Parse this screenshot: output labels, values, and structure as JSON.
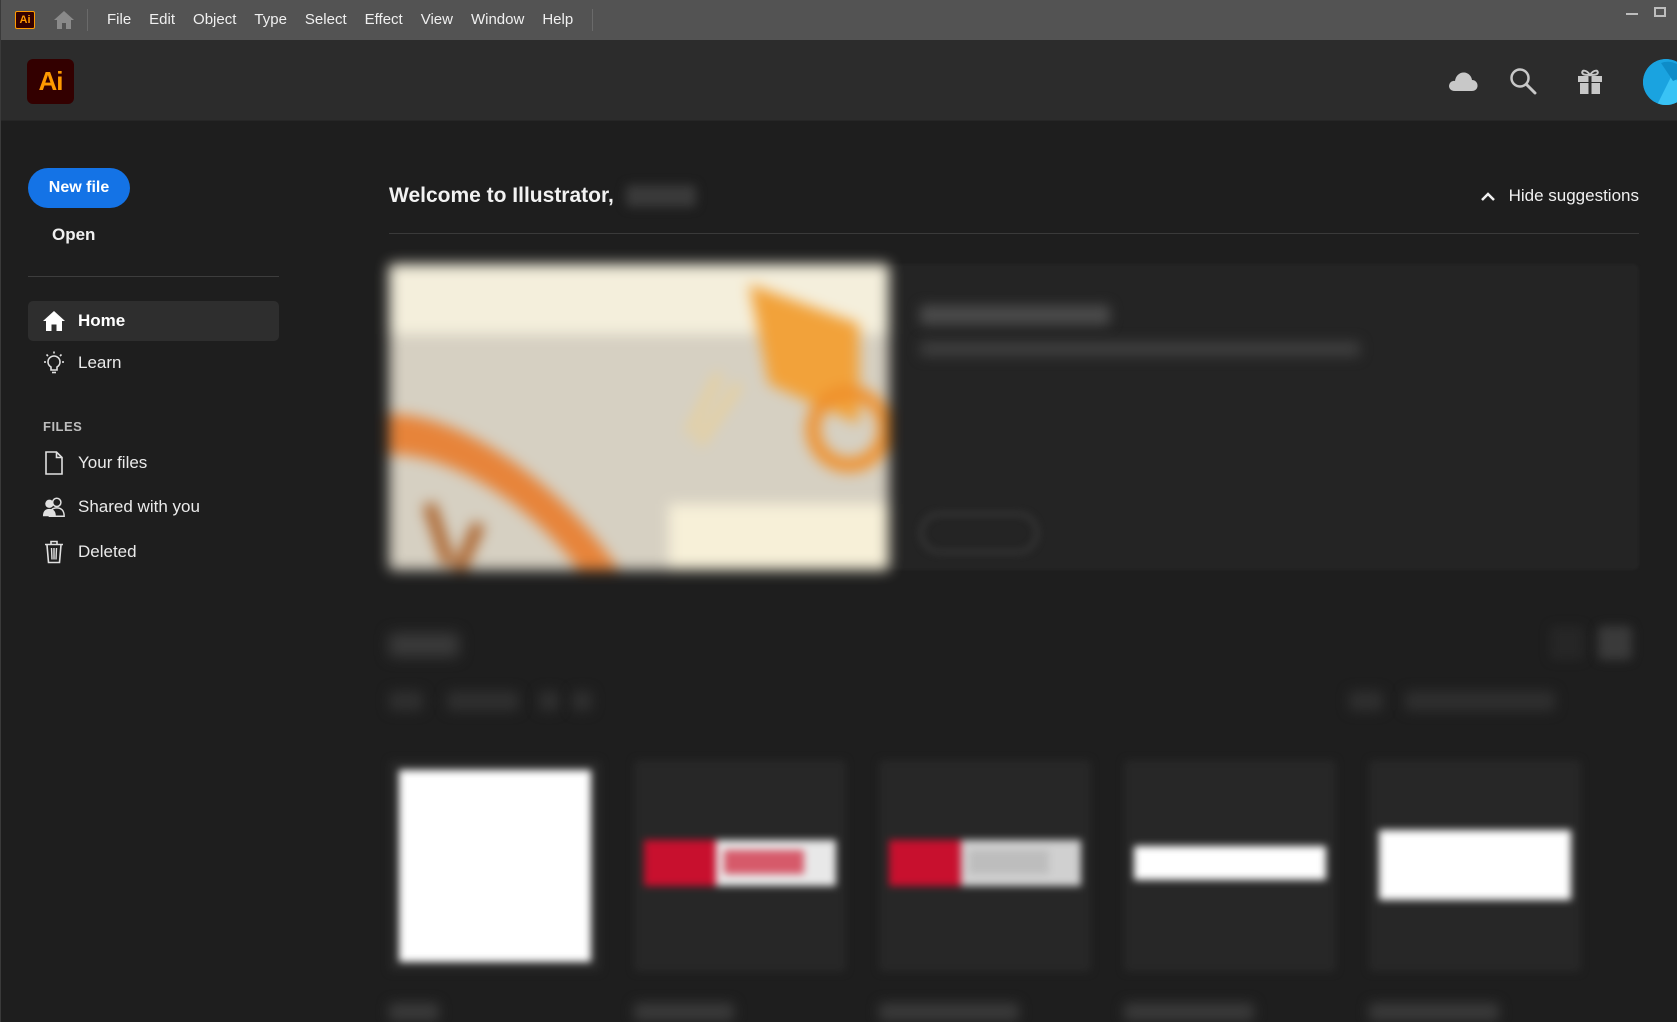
{
  "menubar": {
    "app_badge": "Ai",
    "items": [
      "File",
      "Edit",
      "Object",
      "Type",
      "Select",
      "Effect",
      "View",
      "Window",
      "Help"
    ]
  },
  "header": {
    "logo_text": "Ai",
    "icons": [
      "cloud-icon",
      "search-icon",
      "gift-icon"
    ]
  },
  "sidebar": {
    "new_file": "New file",
    "open": "Open",
    "nav": [
      {
        "label": "Home",
        "icon": "home-icon",
        "active": true
      },
      {
        "label": "Learn",
        "icon": "lightbulb-icon",
        "active": false
      }
    ],
    "files_heading": "FILES",
    "files": [
      {
        "label": "Your files",
        "icon": "document-icon"
      },
      {
        "label": "Shared with you",
        "icon": "people-icon"
      },
      {
        "label": "Deleted",
        "icon": "trash-icon"
      }
    ]
  },
  "main": {
    "welcome": "Welcome to Illustrator,",
    "hide_suggestions": "Hide suggestions"
  },
  "colors": {
    "accent": "#1473e6",
    "brand_orange": "#ff9a00",
    "brand_dark": "#330000",
    "avatar": "#1aa3e0"
  }
}
